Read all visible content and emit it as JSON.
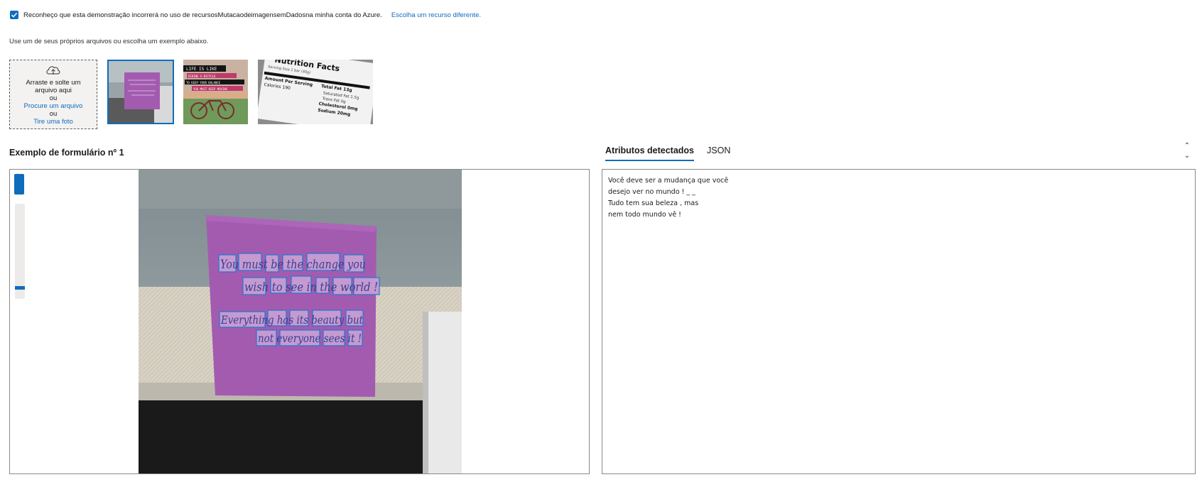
{
  "consent": {
    "checked": true,
    "text": "Reconheço que esta demonstração incorrerá no uso de recursosMutacaodeimagensemDadosna minha conta do Azure.",
    "link": "Escolha um recurso diferente."
  },
  "hint": "Use um de seus próprios arquivos ou escolha um exemplo abaixo.",
  "dropzone": {
    "icon": "cloud-upload-icon",
    "line1": "Arraste e solte um arquivo aqui",
    "or1": "ou",
    "browse_link": "Procure um arquivo",
    "or2": "ou",
    "photo_link": "Tire uma foto"
  },
  "samples": {
    "thumb2_lines": [
      "LIFE IS LIKE",
      "RIDING A BICYCLE",
      "TO KEEP YOUR BALANCE",
      "YOU MUST KEEP MOVING"
    ],
    "thumb3_lines": [
      "Nutrition Facts",
      "Serving Size 1 bar (40g)",
      "Amount Per Serving",
      "Calories 190",
      "Total Fat 13g",
      "Saturated Fat 1.5g",
      "Trans Fat 0g",
      "Cholesterol 0mg",
      "Sodium 20mg"
    ]
  },
  "section_title": "Exemplo de formulário nº 1",
  "viewer": {
    "zoom_level_fraction": 0.9,
    "note_lines": [
      "You must be the change you",
      "wish to see in the world !",
      "Everything has its beauty but",
      "not everyone sees it !"
    ]
  },
  "tabs": [
    "Atributos detectados",
    "JSON"
  ],
  "results": {
    "lines": [
      "Você deve ser a mudança que você",
      "desejo ver no mundo ! _ _",
      "Tudo tem sua beleza , mas",
      "nem todo mundo vê !"
    ]
  },
  "colors": {
    "accent": "#0f6cbd",
    "note": "#a35bb0"
  }
}
